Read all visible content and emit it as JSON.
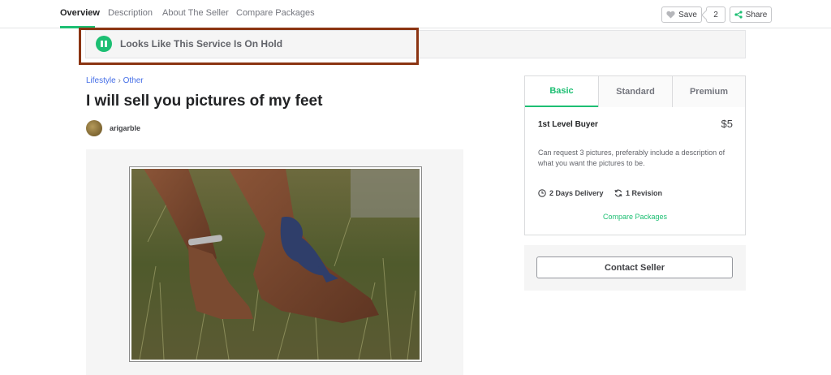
{
  "nav": {
    "tabs": [
      {
        "label": "Overview",
        "active": true
      },
      {
        "label": "Description"
      },
      {
        "label": "About The Seller"
      },
      {
        "label": "Compare Packages"
      }
    ],
    "save_label": "Save",
    "save_count": "2",
    "share_label": "Share"
  },
  "banner": {
    "text": "Looks Like This Service Is On Hold",
    "icon": "pause-icon",
    "highlight_color": "#8b3412"
  },
  "gig": {
    "breadcrumb": {
      "category": "Lifestyle",
      "separator": "›",
      "subcategory": "Other"
    },
    "title": "I will sell you pictures of my feet",
    "seller": "arigarble"
  },
  "package": {
    "tabs": [
      "Basic",
      "Standard",
      "Premium"
    ],
    "active_tab": "Basic",
    "name": "1st Level Buyer",
    "price": "$5",
    "description": "Can request 3 pictures, preferably include a description of what you want the pictures to be.",
    "delivery": "2 Days Delivery",
    "revisions": "1 Revision",
    "compare_link": "Compare Packages"
  },
  "contact": {
    "label": "Contact Seller"
  },
  "colors": {
    "accent": "#1dbf73",
    "link": "#446ee7"
  }
}
